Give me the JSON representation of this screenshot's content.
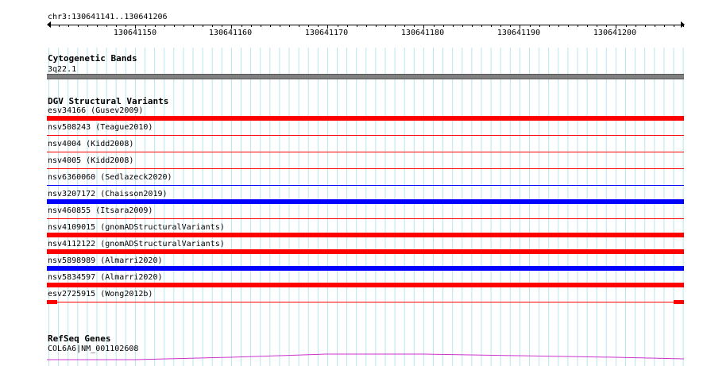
{
  "ruler": {
    "region": "chr3:130641141..130641206",
    "ticks": [
      "130641150",
      "130641160",
      "130641170",
      "130641180",
      "130641190",
      "130641200"
    ]
  },
  "cytoband": {
    "title": "Cytogenetic Bands",
    "band": "3q22.1",
    "color": "#808080"
  },
  "dgv": {
    "title": "DGV Structural Variants",
    "features": [
      {
        "label": "esv34166 (Gusev2009)",
        "color": "#ff0000",
        "style": "full"
      },
      {
        "label": "nsv508243 (Teague2010)",
        "color": "#ff0000",
        "style": "thin"
      },
      {
        "label": "nsv4004 (Kidd2008)",
        "color": "#ff0000",
        "style": "thin"
      },
      {
        "label": "nsv4005 (Kidd2008)",
        "color": "#ff0000",
        "style": "thin"
      },
      {
        "label": "nsv6360060 (Sedlazeck2020)",
        "color": "#0000ff",
        "style": "thin"
      },
      {
        "label": "nsv3207172 (Chaisson2019)",
        "color": "#0000ff",
        "style": "full"
      },
      {
        "label": "nsv460855 (Itsara2009)",
        "color": "#ff0000",
        "style": "thin"
      },
      {
        "label": "nsv4109015 (gnomADStructuralVariants)",
        "color": "#ff0000",
        "style": "full"
      },
      {
        "label": "nsv4112122 (gnomADStructuralVariants)",
        "color": "#ff0000",
        "style": "full"
      },
      {
        "label": "nsv5898989 (Almarri2020)",
        "color": "#0000ff",
        "style": "full"
      },
      {
        "label": "nsv5834597 (Almarri2020)",
        "color": "#ff0000",
        "style": "full"
      },
      {
        "label": "esv2725915 (Wong2012b)",
        "color": "#000000",
        "style": "full"
      }
    ]
  },
  "refseq": {
    "title": "RefSeq Genes",
    "gene": "COL6A6|NM_001102608",
    "color": "#cc33cc"
  }
}
